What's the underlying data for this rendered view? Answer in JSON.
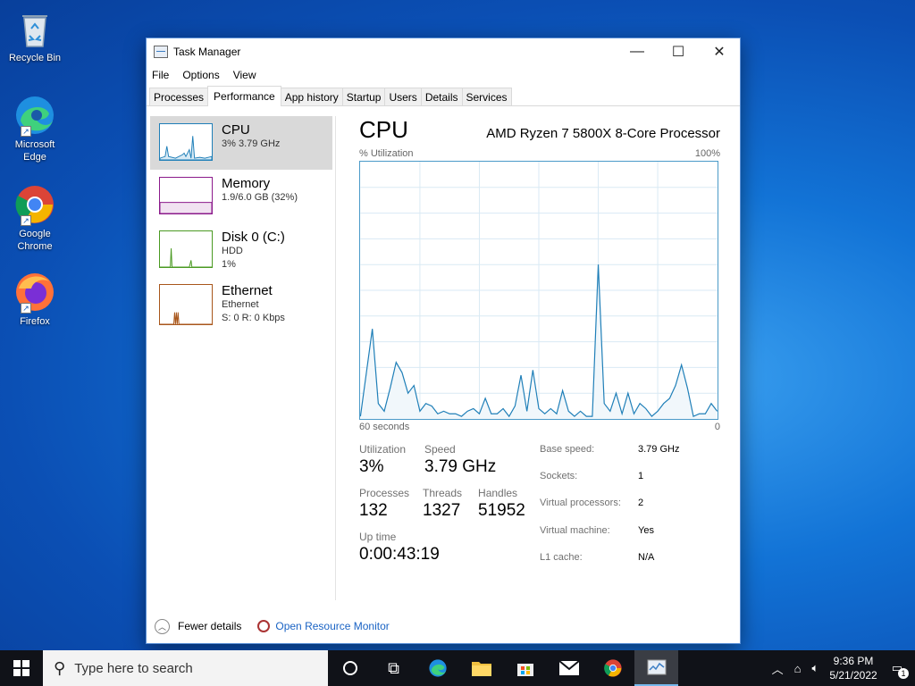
{
  "desktop": {
    "icons": [
      {
        "label": "Recycle Bin"
      },
      {
        "label": "Microsoft Edge"
      },
      {
        "label": "Google Chrome"
      },
      {
        "label": "Firefox"
      }
    ]
  },
  "window": {
    "title": "Task Manager",
    "controls": {
      "minimize": "—",
      "maximize": "☐",
      "close": "✕"
    },
    "menu": [
      "File",
      "Options",
      "View"
    ],
    "tabs": [
      "Processes",
      "Performance",
      "App history",
      "Startup",
      "Users",
      "Details",
      "Services"
    ],
    "active_tab": "Performance"
  },
  "sidebar": {
    "items": [
      {
        "name": "CPU",
        "line1": "3%  3.79 GHz",
        "line2": "",
        "color": "#1f7fb8",
        "fill": "#d8eaf5"
      },
      {
        "name": "Memory",
        "line1": "1.9/6.0 GB (32%)",
        "line2": "",
        "color": "#8b1a8b",
        "fill": "#f1e2f1"
      },
      {
        "name": "Disk 0 (C:)",
        "line1": "HDD",
        "line2": "1%",
        "color": "#4a9a22",
        "fill": "#e5f2dc"
      },
      {
        "name": "Ethernet",
        "line1": "Ethernet",
        "line2": "S: 0  R: 0 Kbps",
        "color": "#a8561b",
        "fill": "#f6e6d8"
      }
    ]
  },
  "main": {
    "title": "CPU",
    "processor": "AMD Ryzen 7 5800X 8-Core Processor",
    "y_label": "% Utilization",
    "y_max_label": "100%",
    "x_left_label": "60 seconds",
    "x_right_label": "0",
    "stats": {
      "utilization_label": "Utilization",
      "utilization": "3%",
      "speed_label": "Speed",
      "speed": "3.79 GHz",
      "processes_label": "Processes",
      "processes": "132",
      "threads_label": "Threads",
      "threads": "1327",
      "handles_label": "Handles",
      "handles": "51952",
      "uptime_label": "Up time",
      "uptime": "0:00:43:19"
    },
    "specs": [
      {
        "k": "Base speed:",
        "v": "3.79 GHz"
      },
      {
        "k": "Sockets:",
        "v": "1"
      },
      {
        "k": "Virtual processors:",
        "v": "2"
      },
      {
        "k": "Virtual machine:",
        "v": "Yes"
      },
      {
        "k": "L1 cache:",
        "v": "N/A"
      }
    ]
  },
  "footer": {
    "fewer_details": "Fewer details",
    "resource_monitor": "Open Resource Monitor"
  },
  "taskbar": {
    "search_placeholder": "Type here to search",
    "time": "9:36 PM",
    "date": "5/21/2022",
    "notification_count": "1"
  },
  "chart_data": {
    "type": "line",
    "x": [
      0,
      1,
      2,
      3,
      4,
      5,
      6,
      7,
      8,
      9,
      10,
      11,
      12,
      13,
      14,
      15,
      16,
      17,
      18,
      19,
      20,
      21,
      22,
      23,
      24,
      25,
      26,
      27,
      28,
      29,
      30,
      31,
      32,
      33,
      34,
      35,
      36,
      37,
      38,
      39,
      40,
      41,
      42,
      43,
      44,
      45,
      46,
      47,
      48,
      49,
      50,
      51,
      52,
      53,
      54,
      55,
      56,
      57,
      58,
      59,
      60
    ],
    "values": [
      1,
      18,
      35,
      6,
      3,
      12,
      22,
      18,
      10,
      13,
      3,
      6,
      5,
      2,
      3,
      2,
      2,
      1,
      3,
      4,
      2,
      8,
      2,
      2,
      4,
      1,
      5,
      17,
      3,
      19,
      4,
      2,
      4,
      2,
      11,
      3,
      1,
      3,
      1,
      1,
      60,
      6,
      3,
      10,
      2,
      10,
      2,
      6,
      4,
      1,
      3,
      6,
      8,
      13,
      21,
      12,
      1,
      2,
      2,
      6,
      3
    ],
    "xlabel": "60 seconds",
    "ylabel": "% Utilization",
    "ylim": [
      0,
      100
    ],
    "grid": true
  }
}
